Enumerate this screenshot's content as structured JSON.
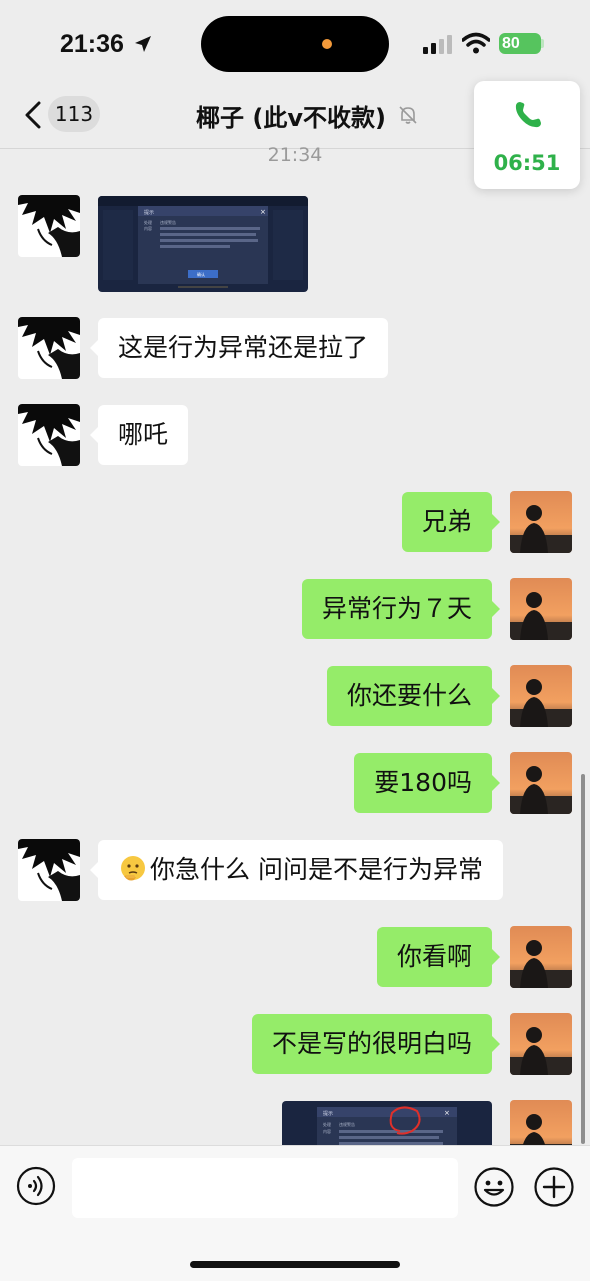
{
  "status_bar": {
    "time": "21:36",
    "battery": "80"
  },
  "nav": {
    "unread_count": "113",
    "title": "椰子 (此v不收款)"
  },
  "call": {
    "duration": "06:51"
  },
  "chat": {
    "timestamp": "21:34",
    "messages": [
      {
        "side": "in",
        "type": "image",
        "preview_lines": [
          "提示",
          "处理",
          "违规警告",
          "内容",
          "确认"
        ]
      },
      {
        "side": "in",
        "type": "text",
        "text": "这是行为异常还是拉了"
      },
      {
        "side": "in",
        "type": "text",
        "text": "哪吒"
      },
      {
        "side": "out",
        "type": "text",
        "text": "兄弟"
      },
      {
        "side": "out",
        "type": "text",
        "text": "异常行为７天"
      },
      {
        "side": "out",
        "type": "text",
        "text": "你还要什么"
      },
      {
        "side": "out",
        "type": "text",
        "text": "要180吗"
      },
      {
        "side": "in",
        "type": "text",
        "text": "你急什么 问问是不是行为异常",
        "emoji": "thinking-face"
      },
      {
        "side": "out",
        "type": "text",
        "text": "你看啊"
      },
      {
        "side": "out",
        "type": "text",
        "text": "不是写的很明白吗"
      },
      {
        "side": "out",
        "type": "image",
        "preview_lines": [
          "提示",
          "处理",
          "违规警告",
          "内容"
        ]
      }
    ]
  },
  "input": {
    "placeholder": ""
  },
  "colors": {
    "outgoing_bubble": "#95ec69",
    "incoming_bubble": "#ffffff",
    "call_green": "#2fb14a",
    "background": "#ededed"
  }
}
